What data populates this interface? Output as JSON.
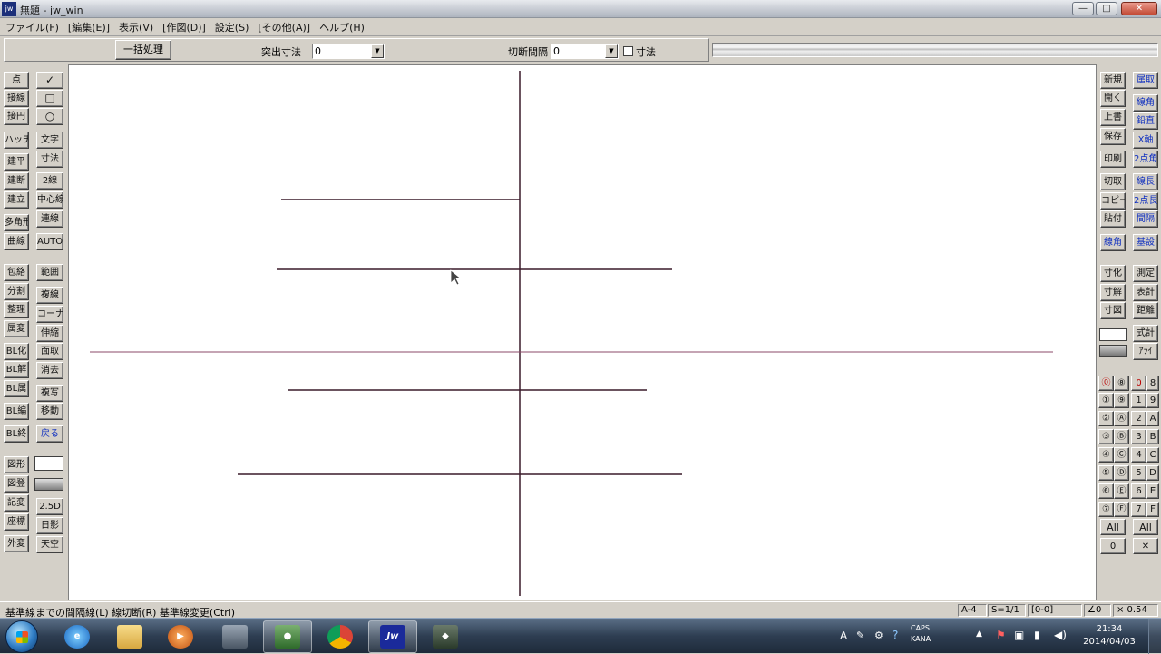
{
  "titlebar": {
    "title": "無題 - jw_win",
    "app_icon_text": "jw",
    "minimize": "—",
    "maximize": "□",
    "close": "✕"
  },
  "menu": [
    "ファイル(F)",
    "[編集(E)]",
    "表示(V)",
    "[作図(D)]",
    "設定(S)",
    "[その他(A)]",
    "ヘルプ(H)"
  ],
  "options": {
    "batch_button": "一括処理",
    "protrude_label": "突出寸法",
    "protrude_value": "0",
    "interval_label": "切断間隔",
    "interval_value": "0",
    "dimension_check_label": "寸法"
  },
  "left_tools": {
    "col1": [
      "点",
      "接線",
      "接円",
      "ハッチ",
      "建平",
      "建断",
      "建立",
      "多角形",
      "曲線",
      "包絡",
      "分割",
      "整理",
      "属変",
      "BL化",
      "BL解",
      "BL属",
      "BL編",
      "BL終",
      "図形",
      "図登",
      "記変",
      "座標",
      "外変"
    ],
    "col2": [
      "✓",
      "□",
      "○",
      "文字",
      "寸法",
      "2線",
      "中心線",
      "連線",
      "AUTO",
      "範囲",
      "複線",
      "コーナー",
      "伸縮",
      "面取",
      "消去",
      "複写",
      "移動",
      "戻る",
      "2.5D",
      "日影",
      "天空"
    ]
  },
  "right_tools": {
    "col1": [
      "新規",
      "開く",
      "上書",
      "保存",
      "印刷",
      "切取",
      "コピー",
      "貼付",
      "線角",
      "寸化",
      "寸解",
      "寸図"
    ],
    "col2": [
      "属取",
      "線角",
      "鉛直",
      "X軸",
      "2点角",
      "線長",
      "2点長",
      "間隔",
      "基設",
      "測定",
      "表計",
      "距離",
      "式計",
      "ｱﾗｲ"
    ],
    "layer_rows": [
      [
        "⓪",
        "⑧",
        "0",
        "8"
      ],
      [
        "①",
        "⑨",
        "1",
        "9"
      ],
      [
        "②",
        "Ⓐ",
        "2",
        "A"
      ],
      [
        "③",
        "Ⓑ",
        "3",
        "B"
      ],
      [
        "④",
        "Ⓒ",
        "4",
        "C"
      ],
      [
        "⑤",
        "Ⓓ",
        "5",
        "D"
      ],
      [
        "⑥",
        "Ⓔ",
        "6",
        "E"
      ],
      [
        "⑦",
        "Ⓕ",
        "7",
        "F"
      ]
    ],
    "all_label": "All",
    "zero_label": "0",
    "x_label": "✕"
  },
  "statusbar": {
    "message": "基準線までの間隔線(L)   線切断(R)   基準線変更(Ctrl)",
    "paper": "A-4",
    "scale": "S=1/1",
    "layer": "[0-0]",
    "angle": "∠0",
    "zoom": "× 0.54"
  },
  "taskbar": {
    "clock_time": "21:34",
    "clock_date": "2014/04/03",
    "tray_lang": "A",
    "tray_caps": "CAPS",
    "tray_kana": "KANA"
  },
  "colors": {
    "drawing_line": "#3a1a2a",
    "reference_line": "#8b4a6a",
    "accent_blue": "#1030c0"
  }
}
